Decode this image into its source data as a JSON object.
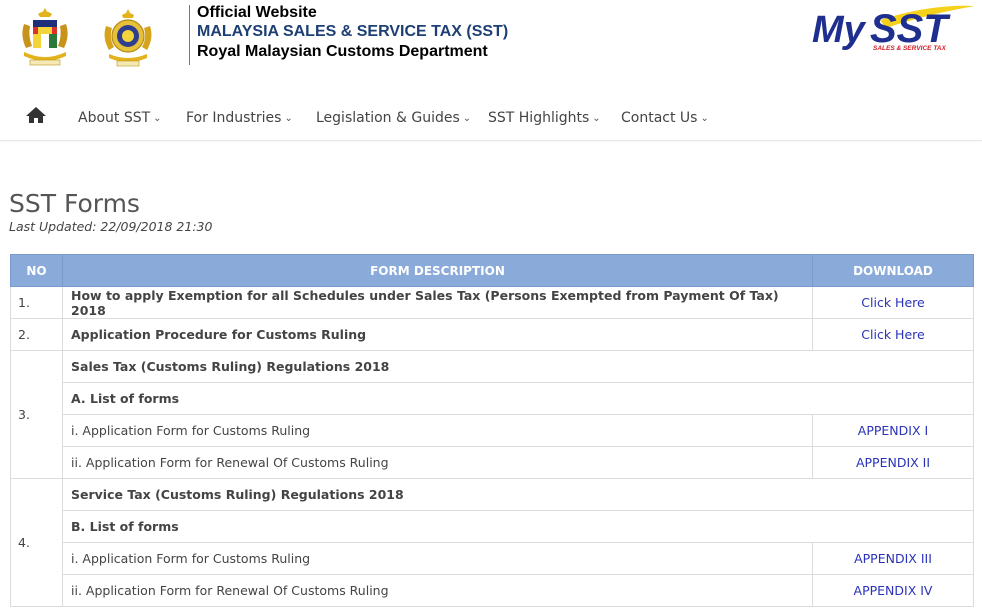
{
  "header": {
    "line1": "Official Website",
    "line2": "MALAYSIA SALES & SERVICE TAX (SST)",
    "line3": "Royal Malaysian Customs Department",
    "logo_text_my": "My",
    "logo_text_sst": "SST",
    "logo_tagline": "SALES & SERVICE TAX"
  },
  "colors": {
    "table_header_bg": "#8aaad9",
    "link": "#2a32b8",
    "logo_blue": "#1f2f8f",
    "logo_yellow": "#f5d11b",
    "logo_red": "#d11f26"
  },
  "nav": {
    "home_icon": "home-icon",
    "items": [
      {
        "label": "About SST"
      },
      {
        "label": "For Industries"
      },
      {
        "label": "Legislation & Guides"
      },
      {
        "label": "SST Highlights"
      },
      {
        "label": "Contact Us"
      }
    ]
  },
  "page": {
    "title": "SST Forms",
    "last_updated": "Last Updated: 22/09/2018 21:30"
  },
  "table": {
    "headers": {
      "no": "NO",
      "desc": "FORM DESCRIPTION",
      "download": "DOWNLOAD"
    },
    "rows": [
      {
        "no": "1.",
        "desc": "How to apply Exemption for all Schedules under Sales Tax (Persons Exempted from Payment Of Tax) 2018",
        "link": "Click Here"
      },
      {
        "no": "2.",
        "desc": "Application Procedure for Customs Ruling",
        "link": "Click Here"
      },
      {
        "no": "3.",
        "title": "Sales Tax (Customs Ruling) Regulations 2018",
        "subtitle": "A. List of forms",
        "items": [
          {
            "desc": "i. Application Form for Customs Ruling",
            "link": "APPENDIX I"
          },
          {
            "desc": "ii. Application Form for Renewal Of Customs Ruling",
            "link": "APPENDIX II"
          }
        ]
      },
      {
        "no": "4.",
        "title": "Service Tax (Customs Ruling) Regulations 2018",
        "subtitle": "B. List of forms",
        "items": [
          {
            "desc": "i. Application Form for Customs Ruling",
            "link": "APPENDIX III"
          },
          {
            "desc": "ii. Application Form for Renewal Of Customs Ruling",
            "link": "APPENDIX IV"
          }
        ]
      }
    ]
  }
}
